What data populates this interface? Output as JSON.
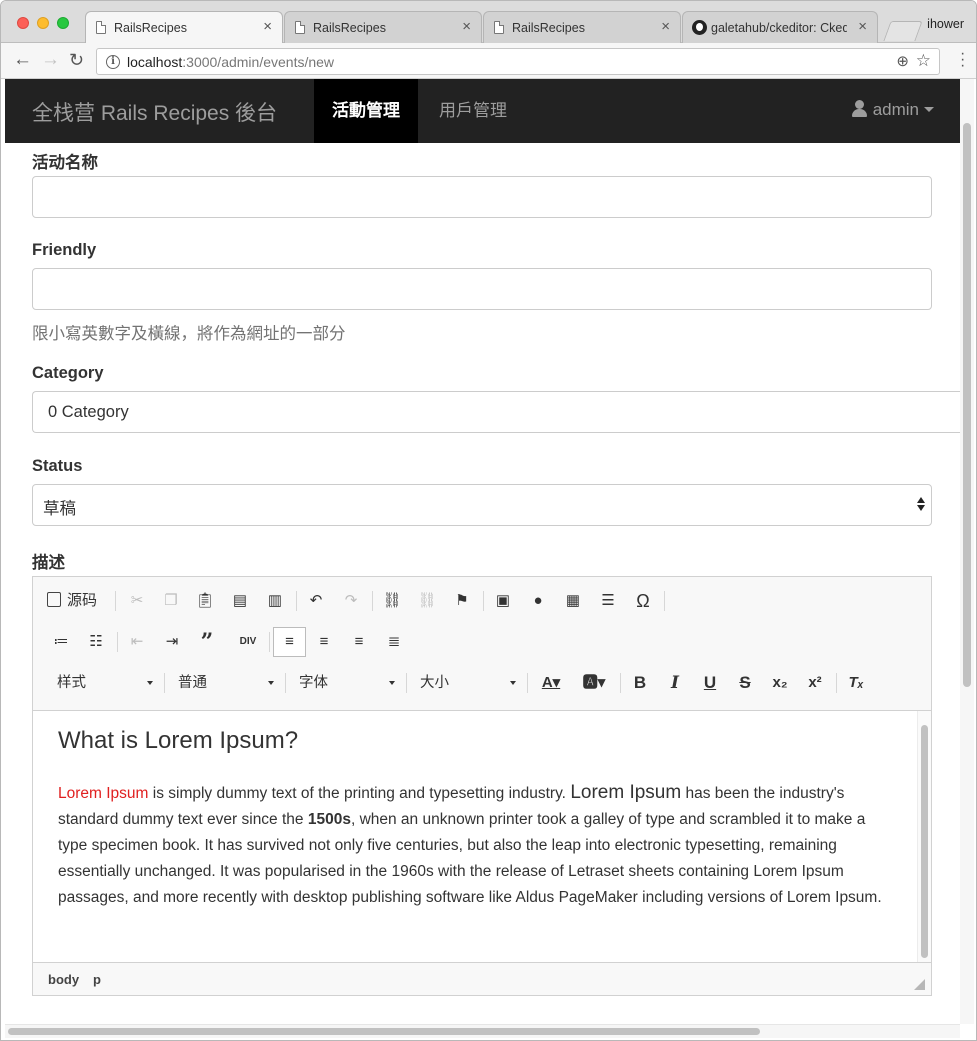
{
  "browser": {
    "tabs": [
      {
        "title": "RailsRecipes",
        "icon": "document-icon",
        "active": true
      },
      {
        "title": "RailsRecipes",
        "icon": "document-icon",
        "active": false
      },
      {
        "title": "RailsRecipes",
        "icon": "document-icon",
        "active": false
      },
      {
        "title": "galetahub/ckeditor: Cked",
        "icon": "github-icon",
        "active": false
      }
    ],
    "profile": "ihower",
    "url_host": "localhost",
    "url_path": ":3000/admin/events/new"
  },
  "navbar": {
    "brand": "全栈营 Rails Recipes 後台",
    "links": [
      {
        "label": "活動管理",
        "active": true
      },
      {
        "label": "用戶管理",
        "active": false
      }
    ],
    "user": "admin"
  },
  "form": {
    "name_label": "活动名称",
    "name_value": "",
    "friendly_label": "Friendly",
    "friendly_value": "",
    "friendly_help": "限小寫英數字及橫線，將作為網址的一部分",
    "category_label": "Category",
    "category_value": "0 Category",
    "status_label": "Status",
    "status_value": "草稿",
    "description_label": "描述"
  },
  "editor": {
    "source_label": "源码",
    "style_combo": "样式",
    "format_combo": "普通",
    "font_combo": "字体",
    "size_combo": "大小",
    "heading": "What is Lorem Ipsum?",
    "para_red": "Lorem Ipsum",
    "para_1": " is simply dummy text of the printing and typesetting industry. ",
    "para_big": "Lorem Ipsum",
    "para_2": " has been the industry's standard dummy text ever since the ",
    "para_bold": "1500s",
    "para_3": ", when an unknown printer took a galley of type and scrambled it to make a type specimen book. It has survived not only five centuries, but also the leap into electronic typesetting, remaining essentially unchanged. It was popularised in the 1960s with the release of Letraset sheets containing Lorem Ipsum passages, and more recently with desktop publishing software like Aldus PageMaker including versions of Lorem Ipsum.",
    "path": [
      "body",
      "p"
    ]
  }
}
